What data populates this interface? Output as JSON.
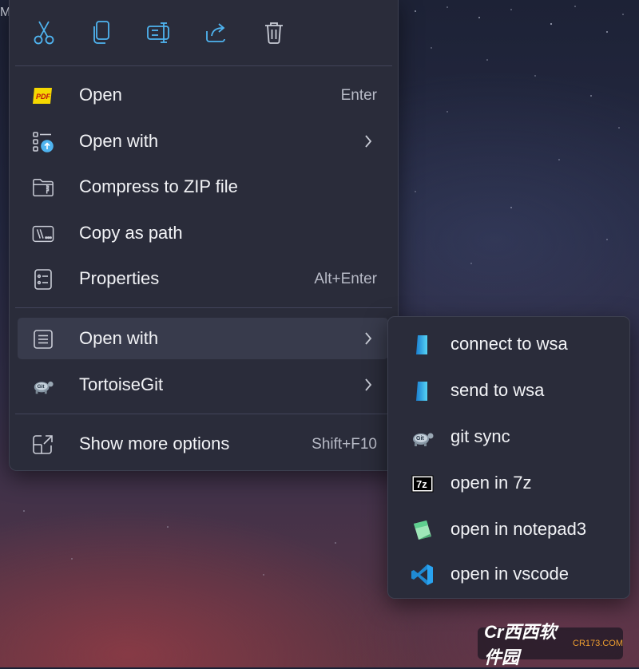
{
  "corner_text": "M",
  "toolbar": {
    "buttons": [
      {
        "icon": "cut-icon"
      },
      {
        "icon": "copy-icon"
      },
      {
        "icon": "rename-icon"
      },
      {
        "icon": "share-icon"
      },
      {
        "icon": "delete-icon"
      }
    ]
  },
  "menu": {
    "items": [
      {
        "label": "Open",
        "shortcut": "Enter",
        "icon": "pdf-icon"
      },
      {
        "label": "Open with",
        "shortcut": "",
        "icon": "open-with-icon",
        "has_submenu": true
      },
      {
        "label": "Compress to ZIP file",
        "shortcut": "",
        "icon": "zip-folder-icon"
      },
      {
        "label": "Copy as path",
        "shortcut": "",
        "icon": "copy-path-icon"
      },
      {
        "label": "Properties",
        "shortcut": "Alt+Enter",
        "icon": "properties-icon"
      }
    ],
    "group2": [
      {
        "label": "Open with",
        "icon": "list-icon",
        "has_submenu": true,
        "highlighted": true
      },
      {
        "label": "TortoiseGit",
        "icon": "tortoisegit-icon",
        "has_submenu": true
      }
    ],
    "more": {
      "label": "Show more options",
      "shortcut": "Shift+F10",
      "icon": "show-more-icon"
    }
  },
  "submenu": {
    "items": [
      {
        "label": "connect to wsa",
        "icon": "wsa-icon"
      },
      {
        "label": "send to wsa",
        "icon": "wsa-icon"
      },
      {
        "label": "git sync",
        "icon": "tortoisegit-icon"
      },
      {
        "label": "open in 7z",
        "icon": "7z-icon"
      },
      {
        "label": "open in notepad3",
        "icon": "notepad3-icon"
      },
      {
        "label": "open in vscode",
        "icon": "vscode-icon"
      }
    ]
  },
  "watermark": {
    "text": "Cr西西软件园",
    "sub": "CR173.COM"
  },
  "colors": {
    "accent": "#4fb4f0",
    "menu_bg": "#2a2c3a",
    "hover_bg": "#383b4c"
  }
}
